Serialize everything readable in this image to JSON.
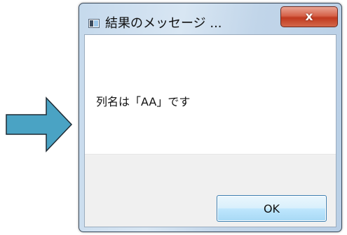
{
  "window": {
    "title": "結果のメッセージ ...",
    "close_label": "x",
    "title_icon": "window-app-icon",
    "close_icon": "close-icon"
  },
  "dialog": {
    "message": "列名は「AA」です",
    "ok_label": "OK"
  },
  "decoration": {
    "arrow_icon": "right-arrow-icon",
    "arrow_color": "#4aa3c4",
    "close_button_color": "#c9472c",
    "ok_border_color": "#3c7fb1"
  }
}
